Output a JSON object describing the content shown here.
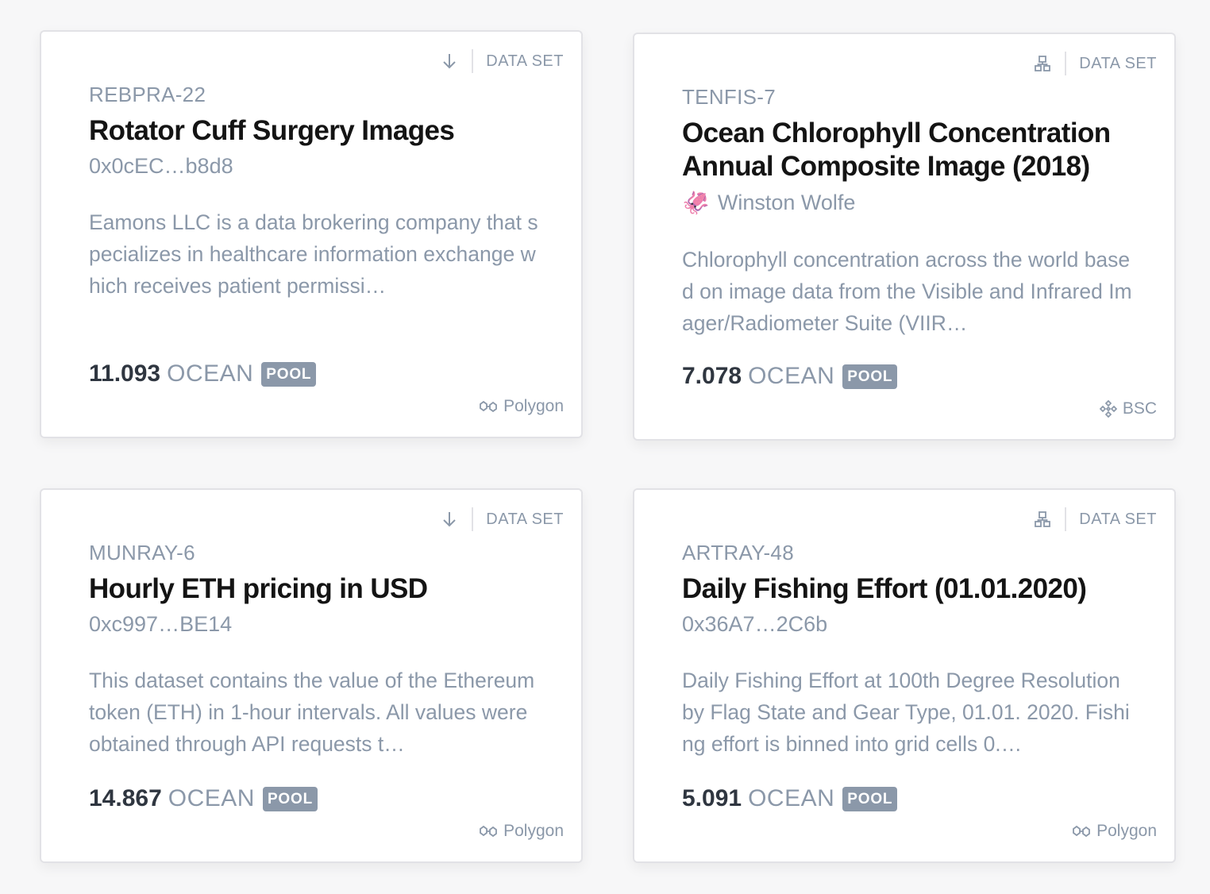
{
  "colors": {
    "muted": "#8b98a9",
    "title": "#141414",
    "border": "#e2e2e6",
    "badge": "#8b98a9"
  },
  "cards": [
    {
      "type_label": "DATA SET",
      "type_icon": "download-arrow-icon",
      "symbol": "REBPRA-22",
      "title": "Rotator Cuff Surgery Images",
      "owner": "0x0cEC…b8d8",
      "description": "Eamons LLC is a data brokering company that specializes in healthcare information exchange which receives patient permissi…",
      "price_value": "11.093",
      "price_unit": "OCEAN",
      "badge": "POOL",
      "network": "Polygon",
      "network_icon": "polygon-icon"
    },
    {
      "type_label": "DATA SET",
      "type_icon": "compute-network-icon",
      "symbol": "TENFIS-7",
      "title": "Ocean Chlorophyll Concentration Annual Composite Image (2018)",
      "owner_emoji": "🦑",
      "owner": "Winston Wolfe",
      "description": "Chlorophyll concentration across the world based on image data from the Visible and Infrared Imager/Radiometer Suite (VIIR…",
      "price_value": "7.078",
      "price_unit": "OCEAN",
      "badge": "POOL",
      "network": "BSC",
      "network_icon": "bsc-icon"
    },
    {
      "type_label": "DATA SET",
      "type_icon": "download-arrow-icon",
      "symbol": "MUNRAY-6",
      "title": "Hourly ETH pricing in USD",
      "owner": "0xc997…BE14",
      "description": "This dataset contains the value of the Ethereum token (ETH) in 1-hour intervals. All values were obtained through API requests t…",
      "price_value": "14.867",
      "price_unit": "OCEAN",
      "badge": "POOL",
      "network": "Polygon",
      "network_icon": "polygon-icon"
    },
    {
      "type_label": "DATA SET",
      "type_icon": "compute-network-icon",
      "symbol": "ARTRAY-48",
      "title": "Daily Fishing Effort (01.01.2020)",
      "owner": "0x36A7…2C6b",
      "description": "Daily Fishing Effort at 100th Degree Resolution by Flag State and Gear Type, 01.01. 2020. Fishing effort is binned into grid cells 0.…",
      "price_value": "5.091",
      "price_unit": "OCEAN",
      "badge": "POOL",
      "network": "Polygon",
      "network_icon": "polygon-icon"
    }
  ]
}
